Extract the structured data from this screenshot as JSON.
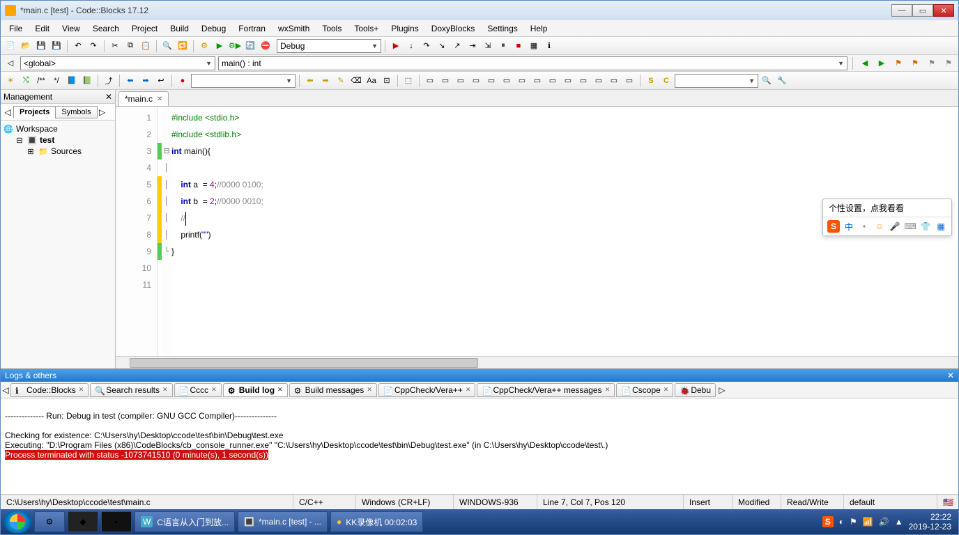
{
  "title": "*main.c [test] - Code::Blocks 17.12",
  "menus": [
    "File",
    "Edit",
    "View",
    "Search",
    "Project",
    "Build",
    "Debug",
    "Fortran",
    "wxSmith",
    "Tools",
    "Tools+",
    "Plugins",
    "DoxyBlocks",
    "Settings",
    "Help"
  ],
  "build_target": "Debug",
  "scope": {
    "global": "<global>",
    "func": "main() : int"
  },
  "management": {
    "title": "Management",
    "tabs": [
      "Projects",
      "Symbols"
    ],
    "workspace": "Workspace",
    "project": "test",
    "folder": "Sources"
  },
  "editor_tab": "*main.c",
  "line_numbers": [
    "1",
    "2",
    "3",
    "4",
    "5",
    "6",
    "7",
    "8",
    "9",
    "10",
    "11"
  ],
  "code": {
    "l1": {
      "pp": "#include <stdio.h>"
    },
    "l2": {
      "pp": "#include <stdlib.h>"
    },
    "l3": {
      "kw": "int",
      "rest": " main(){"
    },
    "l5": {
      "indent": "    ",
      "kw": "int",
      "mid": " a  = ",
      "num": "4",
      "semi": ";",
      "cm": "//0000 0100;"
    },
    "l6": {
      "indent": "    ",
      "kw": "int",
      "mid": " b  = ",
      "num": "2",
      "semi": ";",
      "cm": "//0000 0010;"
    },
    "l7": {
      "indent": "    ",
      "cm": "//"
    },
    "l8": {
      "indent": "    ",
      "call": "printf(",
      "str": "\"\"",
      "close": ")"
    },
    "l9": {
      "brace": "}"
    }
  },
  "logs": {
    "title": "Logs & others",
    "tabs": [
      "Code::Blocks",
      "Search results",
      "Cccc",
      "Build log",
      "Build messages",
      "CppCheck/Vera++",
      "CppCheck/Vera++ messages",
      "Cscope",
      "Debu"
    ],
    "active_tab": "Build log",
    "lines": {
      "runline": "-------------- Run: Debug in test (compiler: GNU GCC Compiler)---------------",
      "check": "Checking for existence: C:\\Users\\hy\\Desktop\\ccode\\test\\bin\\Debug\\test.exe",
      "exec": "Executing: \"D:\\Program Files (x86)\\CodeBlocks/cb_console_runner.exe\" \"C:\\Users\\hy\\Desktop\\ccode\\test\\bin\\Debug\\test.exe\"  (in C:\\Users\\hy\\Desktop\\ccode\\test\\.)",
      "err": "Process terminated with status -1073741510 (0 minute(s), 1 second(s))"
    }
  },
  "status": {
    "path": "C:\\Users\\hy\\Desktop\\ccode\\test\\main.c",
    "lang": "C/C++",
    "eol": "Windows (CR+LF)",
    "enc": "WINDOWS-936",
    "pos": "Line 7, Col 7, Pos 120",
    "ins": "Insert",
    "mod": "Modified",
    "rw": "Read/Write",
    "prof": "default"
  },
  "ime": {
    "tip": "个性设置，点我看看",
    "s_label": "S",
    "cn": "中"
  },
  "taskbar": {
    "items": [
      "C语言从入门到放...",
      "*main.c [test] - ...",
      "KK录像机 00:02:03"
    ],
    "time": "22:22",
    "date": "2019-12-23"
  }
}
